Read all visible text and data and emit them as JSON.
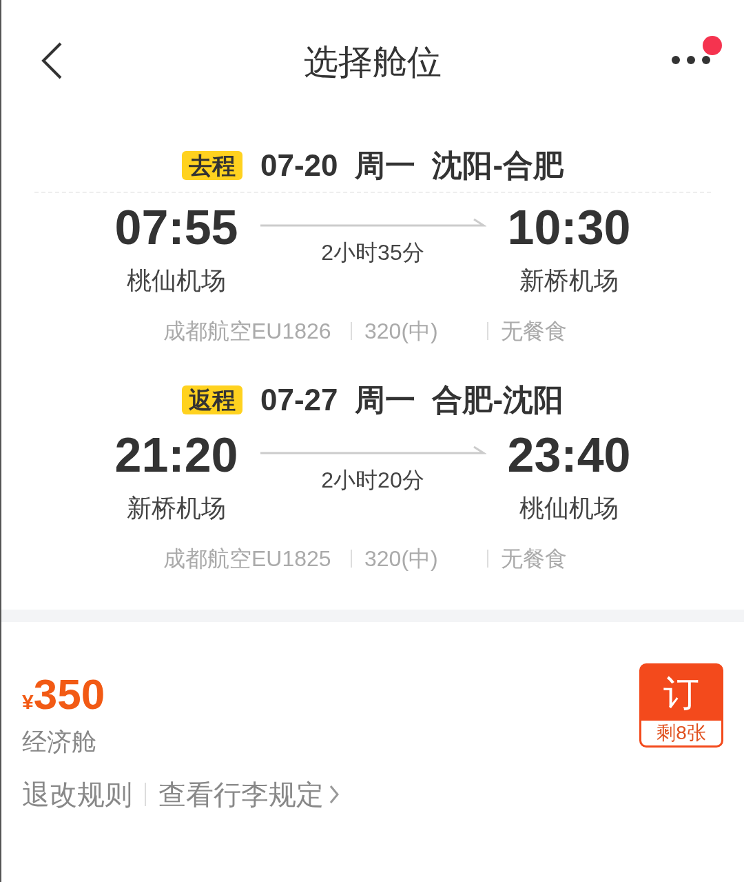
{
  "header": {
    "title": "选择舱位",
    "notification_dot": true
  },
  "segments": [
    {
      "tag": "去程",
      "date": "07-20",
      "weekday": "周一",
      "route": "沈阳-合肥",
      "divider": true,
      "depart_time": "07:55",
      "depart_airport": "桃仙机场",
      "duration": "2小时35分",
      "arrive_time": "10:30",
      "arrive_airport": "新桥机场",
      "airline_flight": "成都航空EU1826",
      "aircraft": "320(中)",
      "meal": "无餐食"
    },
    {
      "tag": "返程",
      "date": "07-27",
      "weekday": "周一",
      "route": "合肥-沈阳",
      "divider": false,
      "depart_time": "21:20",
      "depart_airport": "新桥机场",
      "duration": "2小时20分",
      "arrive_time": "23:40",
      "arrive_airport": "桃仙机场",
      "airline_flight": "成都航空EU1825",
      "aircraft": "320(中)",
      "meal": "无餐食"
    }
  ],
  "fare": {
    "currency": "¥",
    "price": "350",
    "cabin": "经济舱",
    "links": [
      "退改规则",
      "查看行李规定"
    ],
    "book_button": {
      "label": "订",
      "remaining": "剩8张"
    }
  }
}
